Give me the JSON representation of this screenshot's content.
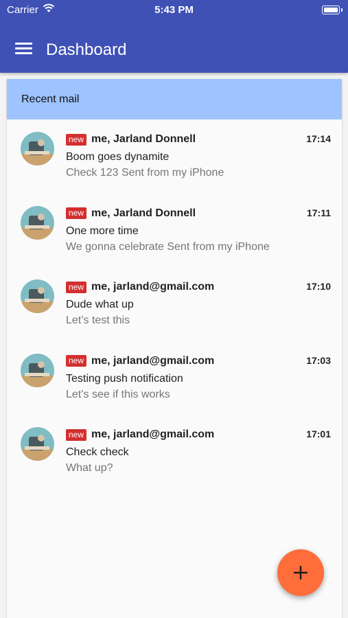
{
  "status_bar": {
    "carrier": "Carrier",
    "time": "5:43 PM"
  },
  "app_bar": {
    "title": "Dashboard",
    "menu_icon": "hamburger-menu-icon",
    "color": "#3f51b5"
  },
  "card": {
    "header": "Recent mail",
    "header_color": "#9ec3ff"
  },
  "mails": [
    {
      "badge": "new",
      "sender": "me, Jarland Donnell",
      "time": "17:14",
      "subject": "Boom goes dynamite",
      "preview": "Check 123 Sent from my iPhone"
    },
    {
      "badge": "new",
      "sender": "me, Jarland Donnell",
      "time": "17:11",
      "subject": "One more time",
      "preview": "We gonna celebrate Sent from my iPhone"
    },
    {
      "badge": "new",
      "sender": "me, jarland@gmail.com",
      "time": "17:10",
      "subject": "Dude what up",
      "preview": "Let’s test this"
    },
    {
      "badge": "new",
      "sender": "me, jarland@gmail.com",
      "time": "17:03",
      "subject": "Testing push notification",
      "preview": "Let’s see if this works"
    },
    {
      "badge": "new",
      "sender": "me, jarland@gmail.com",
      "time": "17:01",
      "subject": "Check check",
      "preview": "What up?"
    }
  ],
  "fab": {
    "icon": "plus-icon",
    "color": "#ff6d3a"
  }
}
